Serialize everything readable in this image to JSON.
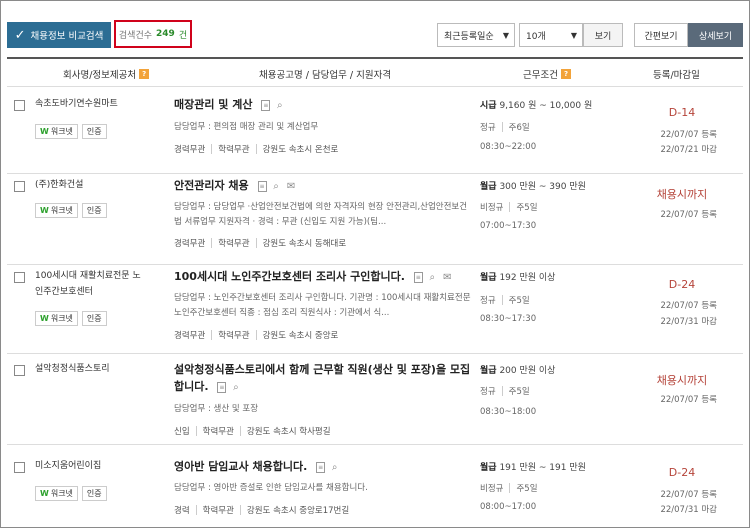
{
  "toolbar": {
    "compare_label": "채용정보 비교검색",
    "count_label": "검색건수",
    "count_value": "249",
    "count_unit": "건",
    "sort_select": "최근등록일순",
    "page_size_select": "10개",
    "view_button": "보기",
    "mode_simple": "간편보기",
    "mode_detail": "상세보기"
  },
  "table": {
    "headers": {
      "company": "회사명/정보제공처",
      "title": "채용공고명 / 담당업무 / 지원자격",
      "condition": "근무조건",
      "registered": "등록/마감일"
    },
    "badge_worknet": "워크넷",
    "badge_cert": "인증",
    "rows": [
      {
        "company": "속초도바기연수원마트",
        "title": "매장관리 및 계산",
        "duty": "담당업무 : 편의점 매장 관리 및 계산업무",
        "career": "경력무관",
        "education": "학력무관",
        "location": "강원도 속초시 온천로",
        "pay": "시급",
        "pay_range": "9,160 원 ~ 10,000 원",
        "employment": "정규",
        "week": "주6일",
        "hours": "08:30~22:00",
        "dday": "D-14",
        "registered": "22/07/07 등록",
        "deadline": "22/07/21 마감"
      },
      {
        "company": "(주)한화건설",
        "title": "안전관리자 채용",
        "duty": "담당업무 : 담당업무 ·산업안전보건법에 의한 자격자의 현장 안전관리,산업안전보건법 서류업무 지원자격 · 경력 : 무관 (신입도 지원 가능)(팀...",
        "career": "경력무관",
        "education": "학력무관",
        "location": "강원도 속초시 동해대로",
        "pay": "월급",
        "pay_range": "300 만원 ~ 390 만원",
        "employment": "비정규",
        "week": "주5일",
        "hours": "07:00~17:30",
        "dday": "채용시까지",
        "registered": "22/07/07 등록",
        "deadline": ""
      },
      {
        "company": "100세시대 재활치료전문 노인주간보호센터",
        "title": "100세시대 노인주간보호센터 조리사 구인합니다.",
        "duty": "담당업무 : 노인주간보호센터 조리사 구인합니다. 기관명 : 100세시대 재활치료전문 노인주간보호센터 직종 : 점심 조리 직원식사 : 기관에서 식...",
        "career": "경력무관",
        "education": "학력무관",
        "location": "강원도 속초시 중앙로",
        "pay": "월급",
        "pay_range": "192 만원 이상",
        "employment": "정규",
        "week": "주5일",
        "hours": "08:30~17:30",
        "dday": "D-24",
        "registered": "22/07/07 등록",
        "deadline": "22/07/31 마감"
      },
      {
        "company": "설악청정식품스토리",
        "title": "설악청정식품스토리에서 함께 근무할 직원(생산 및 포장)을 모집합니다.",
        "duty": "담당업무 : 생산 및 포장",
        "career": "신입",
        "education": "학력무관",
        "location": "강원도 속초시 학사평길",
        "pay": "월급",
        "pay_range": "200 만원 이상",
        "employment": "정규",
        "week": "주5일",
        "hours": "08:30~18:00",
        "dday": "채용시까지",
        "registered": "22/07/07 등록",
        "deadline": ""
      },
      {
        "company": "미소지움어린이집",
        "title": "영아반 담임교사 채용합니다.",
        "duty": "담당업무 : 영아반 증설로 인한 담임교사를 채용합니다.",
        "career": "경력",
        "education": "학력무관",
        "location": "강원도 속초시 중앙로17번길",
        "pay": "월급",
        "pay_range": "191 만원 ~ 191 만원",
        "employment": "비정규",
        "week": "주5일",
        "hours": "08:00~17:00",
        "dday": "D-24",
        "registered": "22/07/07 등록",
        "deadline": "22/07/31 마감"
      }
    ]
  }
}
